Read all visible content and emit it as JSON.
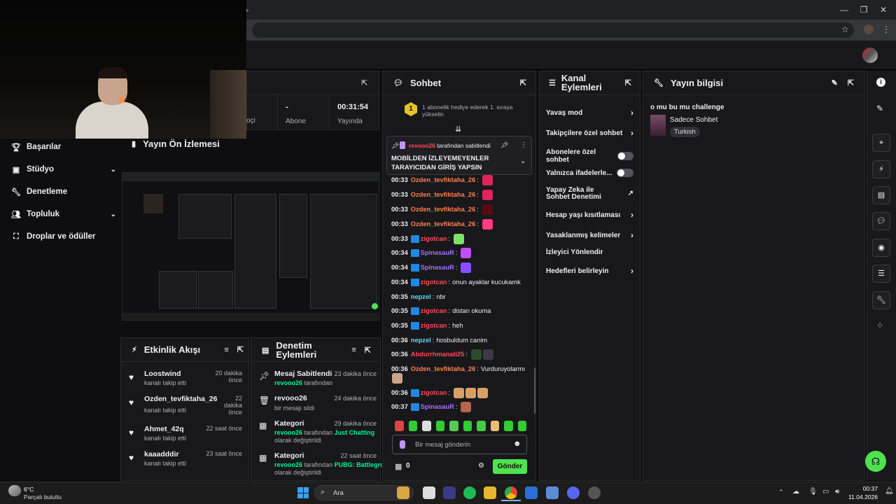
{
  "browser": {
    "new_tab_symbol": "+",
    "window_controls": [
      "—",
      "❐",
      "✕"
    ]
  },
  "top_panel": {
    "stat_dash": "-",
    "stat_sub_label": "Abone",
    "stat_sub_label2": "Sayısı",
    "stat_time": "00:31:54",
    "stat_time_label": "Yayında",
    "stat_time_label2": "Olduğu",
    "stat_left_fragment": "oçi"
  },
  "left_nav": {
    "items": [
      {
        "label": "Başarılar",
        "icon": "trophy-icon"
      },
      {
        "label": "Stüdyo",
        "icon": "studio-icon",
        "chevron": true
      },
      {
        "label": "Denetleme",
        "icon": "wrench-icon"
      },
      {
        "label": "Topluluk",
        "icon": "community-icon",
        "chevron": true
      },
      {
        "label": "Droplar ve ödüller",
        "icon": "drops-icon"
      }
    ]
  },
  "preview": {
    "title": "Yayın Ön İzlemesi"
  },
  "activity": {
    "title": "Etkinlik Akışı",
    "items": [
      {
        "name": "Loostwind",
        "sub": "kanalı takip etti",
        "time": "20 dakika önce"
      },
      {
        "name": "Ozden_tevfiktaha_26",
        "sub": "kanalı takip etti",
        "time": "22 dakika önce"
      },
      {
        "name": "Ahmet_42q",
        "sub": "kanalı takip etti",
        "time": "22 saat önce"
      },
      {
        "name": "kaaadddir",
        "sub": "kanalı takip etti",
        "time": "23 saat önce"
      }
    ]
  },
  "moderation": {
    "title": "Denetim Eylemleri",
    "items": [
      {
        "title": "Mesaj Sabitlendi",
        "user": "revooo26",
        "rest": "tarafından",
        "extra": "",
        "time": "23 dakika önce"
      },
      {
        "title": "revooo26",
        "user": "",
        "rest": "bir mesajı sildi",
        "extra": "",
        "time": "24 dakika önce"
      },
      {
        "title": "Kategori",
        "user": "revooo26",
        "rest": "tarafından",
        "highlight": "Just Chatting",
        "extra": "olarak değiştirildi",
        "time": "29 dakika önce"
      },
      {
        "title": "Kategori",
        "user": "revooo26",
        "rest": "tarafından",
        "highlight": "PUBG: Battlegrounds",
        "extra": "olarak değiştirildi",
        "time": "22 saat önce"
      }
    ]
  },
  "chat": {
    "title": "Sohbet",
    "gift_count": "1",
    "gift_text": "1 abonelik hediye ederek 1. sıraya yükselin",
    "pinned": {
      "by_user": "revooo26",
      "by_text": "tarafından sabitlendi",
      "message": "MOBİLDEN İZLEYEMEYENLER TARAYICIDAN GİRİŞ YAPSIN"
    },
    "messages": [
      {
        "time": "00:33",
        "user": "Ozden_tevfiktaha_26",
        "color": "#ff7f50",
        "text": "",
        "badge": false,
        "emotes": [
          "#e0245e"
        ]
      },
      {
        "time": "00:33",
        "user": "Ozden_tevfiktaha_26",
        "color": "#ff7f50",
        "text": "",
        "badge": false,
        "emotes": [
          "#e0245e"
        ]
      },
      {
        "time": "00:33",
        "user": "Ozden_tevfiktaha_26",
        "color": "#ff7f50",
        "text": "",
        "badge": false,
        "emotes": [
          "#5a0a14"
        ]
      },
      {
        "time": "00:33",
        "user": "Ozden_tevfiktaha_26",
        "color": "#ff7f50",
        "text": "",
        "badge": false,
        "emotes": [
          "#ff3d7f"
        ]
      },
      {
        "time": "00:33",
        "user": "zigotcan",
        "color": "#ff4a55",
        "text": "",
        "badge": true,
        "emotes": [
          "#7ce36a"
        ]
      },
      {
        "time": "00:34",
        "user": "SpinasauR",
        "color": "#a970ff",
        "text": "",
        "badge": true,
        "emotes": [
          "#c44dff"
        ]
      },
      {
        "time": "00:34",
        "user": "SpinasauR",
        "color": "#a970ff",
        "text": "",
        "badge": true,
        "emotes": [
          "#8a4dff"
        ]
      },
      {
        "time": "00:34",
        "user": "zigotcan",
        "color": "#ff4a55",
        "text": "onun ayaklar kucukamk",
        "badge": true,
        "emotes": []
      },
      {
        "time": "00:35",
        "user": "nepzel",
        "color": "#5dd6ff",
        "text": "nbr",
        "badge": false,
        "emotes": []
      },
      {
        "time": "00:35",
        "user": "zigotcan",
        "color": "#ff4a55",
        "text": "distan okuma",
        "badge": true,
        "emotes": []
      },
      {
        "time": "00:35",
        "user": "zigotcan",
        "color": "#ff4a55",
        "text": "heh",
        "badge": true,
        "emotes": []
      },
      {
        "time": "00:36",
        "user": "nepzel",
        "color": "#5dd6ff",
        "text": "hosbuldum canim",
        "badge": false,
        "emotes": []
      },
      {
        "time": "00:36",
        "user": "Abdurrhmanali25",
        "color": "#ff4a55",
        "text": "",
        "badge": false,
        "emotes": [
          "#2e4a2e",
          "#3a3a4a"
        ]
      },
      {
        "time": "00:36",
        "user": "Ozden_tevfiktaha_26",
        "color": "#ff7f50",
        "text": "Vurduruyolarmı",
        "badge": false,
        "emotes": []
      },
      {
        "time": "00:36",
        "user": "zigotcan",
        "color": "#ff4a55",
        "text": "",
        "badge": true,
        "emotes": [
          "#d9a066",
          "#d9a066",
          "#d9a066"
        ]
      },
      {
        "time": "00:37",
        "user": "SpinasauR",
        "color": "#a970ff",
        "text": "",
        "badge": true,
        "emotes": [
          "#b5654a"
        ]
      }
    ],
    "input_placeholder": "Bir mesaj gönderin",
    "points": "0",
    "send_label": "Gönder"
  },
  "channel_actions": {
    "title": "Kanal Eylemleri",
    "items": [
      {
        "label": "Yavaş mod",
        "type": "chevron"
      },
      {
        "label": "Takipçilere özel sohbet",
        "type": "chevron"
      },
      {
        "label": "Abonelere özel sohbet",
        "type": "toggle"
      },
      {
        "label": "Yalnızca ifadelerle...",
        "type": "toggle"
      },
      {
        "label": "Yapay Zeka ile Sohbet Denetimi",
        "type": "external"
      },
      {
        "label": "Hesap yaşı kısıtlaması",
        "type": "chevron"
      },
      {
        "label": "Yasaklanmış kelimeler",
        "type": "chevron"
      },
      {
        "label": "İzleyici Yönlendir",
        "type": "none"
      },
      {
        "label": "Hedefleri belirleyin",
        "type": "chevron"
      }
    ]
  },
  "stream_info": {
    "title": "Yayın bilgisi",
    "stream_title": "o mu bu mu challenge",
    "category": "Sadece Sohbet",
    "tag": "Turkish"
  },
  "taskbar": {
    "weather_temp": "6°C",
    "weather_desc": "Parçalı bulutlu",
    "search_label": "Ara",
    "time": "00:37",
    "date": "11.04.2026"
  },
  "colors": {
    "accent_purple": "#9147ff",
    "send_green": "#4ee34e",
    "background": "#0e0e10",
    "panel": "#18181b"
  }
}
